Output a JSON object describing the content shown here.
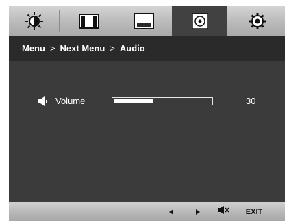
{
  "tabs": [
    {
      "id": "picture",
      "icon": "brightness-icon",
      "active": false
    },
    {
      "id": "color",
      "icon": "color-bars-icon",
      "active": false
    },
    {
      "id": "display",
      "icon": "screen-icon",
      "active": false
    },
    {
      "id": "audio",
      "icon": "speaker-disc-icon",
      "active": true
    },
    {
      "id": "settings",
      "icon": "gear-icon",
      "active": false
    }
  ],
  "breadcrumb": {
    "menu": "Menu",
    "separator1": ">",
    "next_menu": "Next Menu",
    "separator2": ">",
    "current": "Audio"
  },
  "volume": {
    "icon": "speaker-icon",
    "label": "Volume",
    "value": "30",
    "level_fraction": 0.4
  },
  "bottom_bar": {
    "left_icon": "left-arrow-icon",
    "right_icon": "right-arrow-icon",
    "mute_icon": "mute-icon",
    "exit_label": "EXIT"
  },
  "colors": {
    "panel_bg": "#3b3b3b",
    "breadcrumb_bg": "#2a2a2a",
    "active_tab_bg": "#414141",
    "text": "#ffffff"
  }
}
